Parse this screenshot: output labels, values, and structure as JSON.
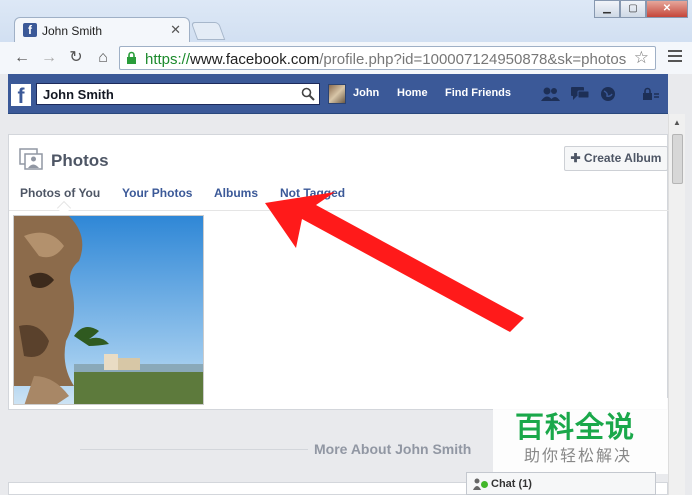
{
  "browser": {
    "tab_title": "John Smith",
    "url_scheme": "https://",
    "url_domain": "www.facebook.com",
    "url_path": "/profile.php?id=100007124950878&sk=photos"
  },
  "fb": {
    "search_value": "John Smith",
    "nav": {
      "profile": "John",
      "home": "Home",
      "find_friends": "Find Friends"
    }
  },
  "photos": {
    "title": "Photos",
    "create_album": "Create Album",
    "tabs": [
      "Photos of You",
      "Your Photos",
      "Albums",
      "Not Tagged"
    ],
    "active_tab": "Photos of You"
  },
  "more_about": "More About John Smith",
  "chat": {
    "label": "Chat (1)"
  },
  "watermark": {
    "line1": "百科全说",
    "line2": "助你轻松解决"
  },
  "colors": {
    "fb_blue": "#3b5998",
    "arrow_red": "#ff1a1a",
    "watermark_green": "#1aa84a"
  }
}
